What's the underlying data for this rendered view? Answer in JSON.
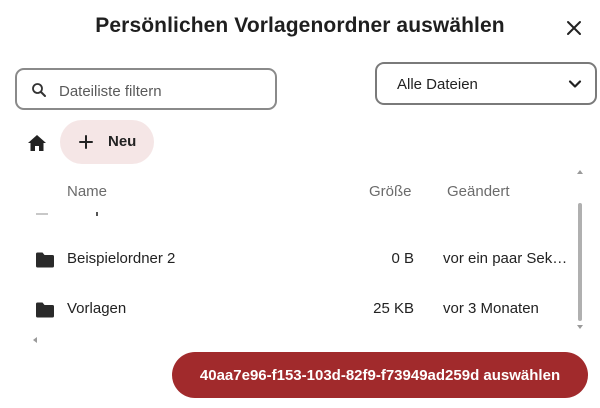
{
  "dialog": {
    "title": "Persönlichen Vorlagenordner auswählen",
    "close_icon": "close-icon"
  },
  "filter": {
    "search_placeholder": "Dateiliste filtern",
    "search_value": "",
    "search_icon": "search-icon",
    "type_select_value": "Alle Dateien",
    "type_select_icon": "chevron-down-icon"
  },
  "toolbar": {
    "home_icon": "home-icon",
    "new_label": "Neu",
    "new_icon": "plus-icon"
  },
  "table": {
    "columns": [
      "Name",
      "Größe",
      "Geändert"
    ],
    "rows": [
      {
        "name": "Beispielordner 2",
        "size": "0 B",
        "modified": "vor ein paar Sekunden",
        "icon": "folder-icon"
      },
      {
        "name": "Vorlagen",
        "size": "25 KB",
        "modified": "vor 3 Monaten",
        "icon": "folder-icon"
      }
    ]
  },
  "footer": {
    "choose_label": "40aa7e96-f153-103d-82f9-f73949ad259d auswählen"
  },
  "colors": {
    "primary": "#a12a2c",
    "new_button_bg": "#f5e6e6"
  }
}
